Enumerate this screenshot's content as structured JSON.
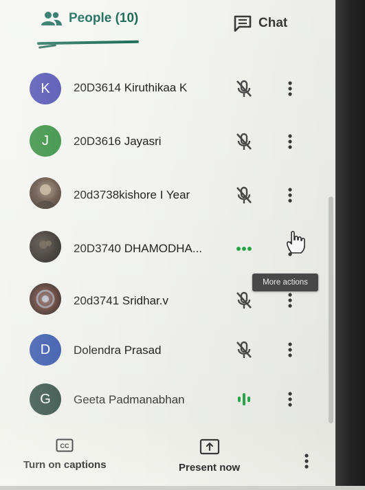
{
  "tabs": {
    "people_label": "People (10)",
    "chat_label": "Chat"
  },
  "participants": [
    {
      "initial": "K",
      "name": "20D3614 Kiruthikaa K",
      "avatar_color": "#4a4bb0",
      "status": "muted"
    },
    {
      "initial": "J",
      "name": "20D3616 Jayasri",
      "avatar_color": "#2f8a3a",
      "status": "muted"
    },
    {
      "initial": "",
      "name": "20d3738kishore I Year",
      "avatar_color": "#5b4638",
      "status": "muted"
    },
    {
      "initial": "",
      "name": "20D3740 DHAMODHA...",
      "avatar_color": "#2a2520",
      "status": "dots"
    },
    {
      "initial": "",
      "name": "20d3741 Sridhar.v",
      "avatar_color": "#4a2f2a",
      "status": "muted"
    },
    {
      "initial": "D",
      "name": "Dolendra Prasad",
      "avatar_color": "#2f4fa8",
      "status": "muted"
    },
    {
      "initial": "G",
      "name": "Geeta Padmanabhan",
      "avatar_color": "#2d4a40",
      "status": "speaking"
    }
  ],
  "tooltip": "More actions",
  "bottombar": {
    "captions_label": "Turn on captions",
    "captions_icon": "CC",
    "present_label": "Present now"
  },
  "colors": {
    "accent": "#1b6b57",
    "speaking": "#2aa84a",
    "icon_gray": "#4a4a4a"
  }
}
